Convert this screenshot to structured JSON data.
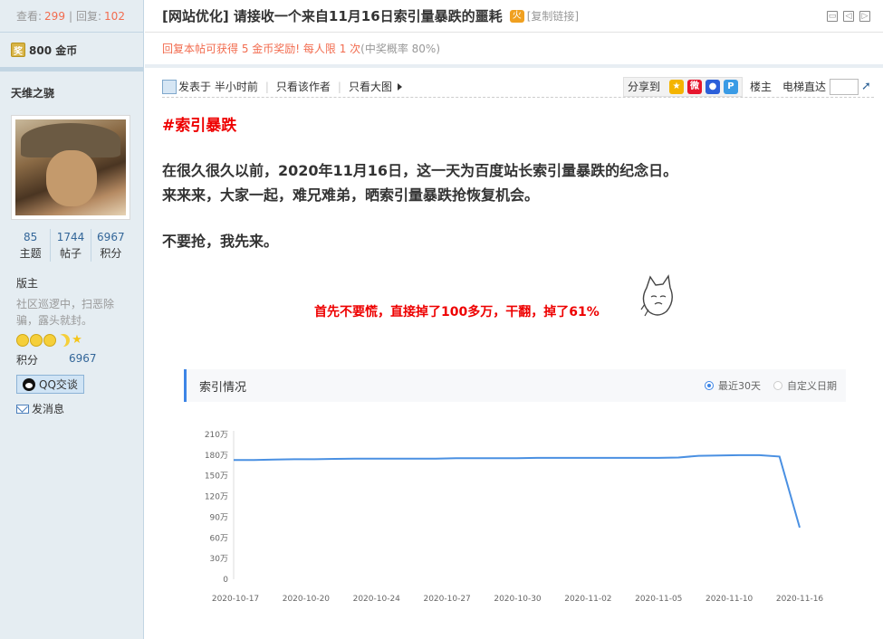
{
  "sidebar": {
    "stats": {
      "views_label": "查看:",
      "views": "299",
      "sep": "|",
      "replies_label": "回复:",
      "replies": "102"
    },
    "coin_icon": "奖",
    "coins": "800 金币",
    "username": "天维之骁",
    "user_stats": [
      {
        "value": "85",
        "label": "主题"
      },
      {
        "value": "1744",
        "label": "帖子"
      },
      {
        "value": "6967",
        "label": "积分"
      }
    ],
    "role": "版主",
    "role_desc": "社区巡逻中，扫恶除骗，露头就封。",
    "score_label": "积分",
    "score_value": "6967",
    "qq_label": "QQ交谈",
    "message_label": "发消息"
  },
  "thread": {
    "title": "[网站优化] 请接收一个来自11月16日索引量暴跌的噩耗",
    "hot_icon": "火",
    "copy_link": "[复制链接]",
    "reward_main": "回复本帖可获得 5 金币奖励! 每人限 1 次",
    "reward_rate": "(中奖概率 80%)"
  },
  "meta": {
    "posted": "发表于 半小时前",
    "only_author": "只看该作者",
    "big_image": "只看大图",
    "share_label": "分享到",
    "floor": "楼主",
    "jump_label": "电梯直达"
  },
  "post": {
    "tag": "#索引暴跌",
    "line1": "在很久很久以前，2020年11月16日，这一天为百度站长索引量暴跌的纪念日。",
    "line2": "来来来，大家一起，难兄难弟，晒索引量暴跌抢恢复机会。",
    "line3": "不要抢，我先来。",
    "note": "首先不要慌，直接掉了100多万，干翻，掉了61%"
  },
  "chart_panel": {
    "title": "索引情况",
    "radio_recent": "最近30天",
    "radio_custom": "自定义日期"
  },
  "chart_data": {
    "type": "line",
    "yticks": [
      "0",
      "30万",
      "60万",
      "90万",
      "120万",
      "150万",
      "180万",
      "210万"
    ],
    "yvalues": [
      0,
      30,
      60,
      90,
      120,
      150,
      180,
      210
    ],
    "ylim": [
      0,
      210
    ],
    "xticks": [
      "2020-10-17",
      "2020-10-20",
      "2020-10-24",
      "2020-10-27",
      "2020-10-30",
      "2020-11-02",
      "2020-11-05",
      "2020-11-10",
      "2020-11-16"
    ],
    "series": [
      {
        "values": [
          173,
          173,
          173.5,
          174,
          174,
          174.5,
          175,
          175,
          175,
          175,
          175,
          175.5,
          175.5,
          175.5,
          175.5,
          176,
          176,
          176,
          176,
          176,
          176,
          176,
          176.5,
          179,
          179.5,
          180,
          180,
          178,
          75
        ]
      }
    ],
    "line_color": "#4a90e2",
    "grid": false
  },
  "colors": {
    "accent": "#336699",
    "red": "#e00000",
    "reward": "#f26c4f",
    "line": "#4a90e2"
  }
}
